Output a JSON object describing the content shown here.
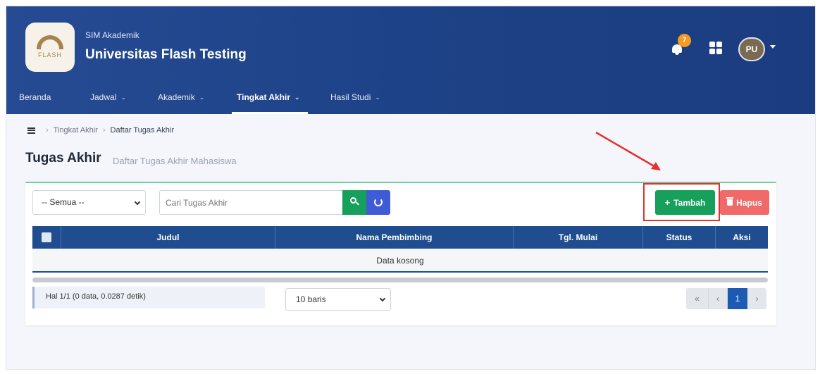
{
  "header": {
    "app_subtitle": "SIM Akademik",
    "app_title": "Universitas Flash Testing",
    "logo_text": "FLASH",
    "notification_count": "7",
    "user_initials": "PU",
    "brand_color": "#1e4287"
  },
  "nav": {
    "items": [
      {
        "label": "Beranda",
        "has_dropdown": false
      },
      {
        "label": "Jadwal",
        "has_dropdown": true
      },
      {
        "label": "Akademik",
        "has_dropdown": true
      },
      {
        "label": "Tingkat Akhir",
        "has_dropdown": true,
        "active": true
      },
      {
        "label": "Hasil Studi",
        "has_dropdown": true
      }
    ]
  },
  "breadcrumb": {
    "items": [
      "Tingkat Akhir",
      "Daftar Tugas Akhir"
    ]
  },
  "page": {
    "title": "Tugas Akhir",
    "subtitle": "Daftar Tugas Akhir Mahasiswa"
  },
  "toolbar": {
    "filter_value": "-- Semua --",
    "search_placeholder": "Cari Tugas Akhir",
    "add_label": "Tambah",
    "delete_label": "Hapus",
    "add_color": "#17a05c",
    "delete_color": "#f06a6a"
  },
  "table": {
    "columns": [
      "Judul",
      "Nama Pembimbing",
      "Tgl. Mulai",
      "Status",
      "Aksi"
    ],
    "empty_text": "Data kosong"
  },
  "footer": {
    "info": "Hal 1/1 (0 data, 0.0287 detik)",
    "per_page": "10 baris",
    "pages": {
      "first": "«",
      "prev": "‹",
      "current": "1",
      "next": "›"
    }
  },
  "icons": {
    "notification": "bell-icon",
    "apps": "grid-icon",
    "search": "search-icon",
    "refresh": "refresh-icon",
    "add": "plus-icon",
    "delete": "trash-icon"
  }
}
